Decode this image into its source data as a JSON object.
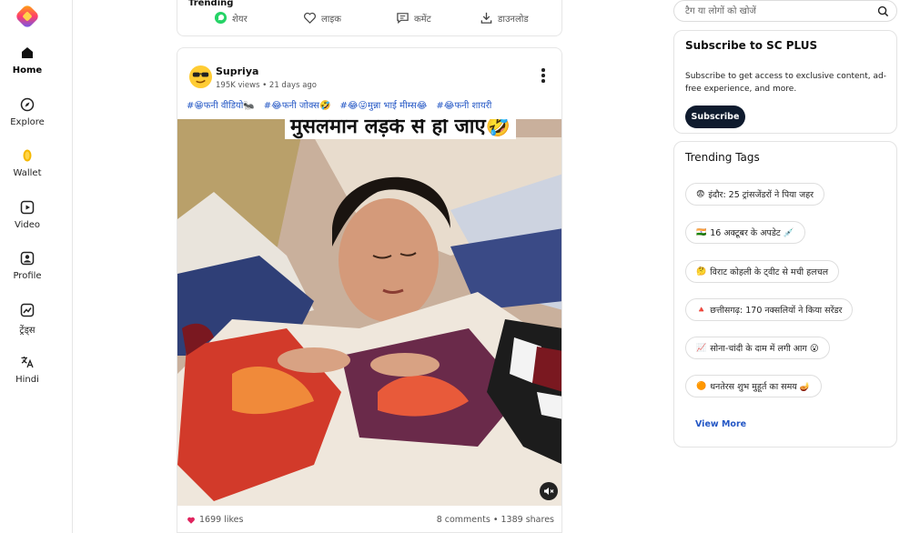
{
  "sidebar": {
    "items": [
      {
        "label": "Home",
        "icon": "home-icon"
      },
      {
        "label": "Explore",
        "icon": "compass-icon"
      },
      {
        "label": "Wallet",
        "icon": "coin-icon"
      },
      {
        "label": "Video",
        "icon": "video-icon"
      },
      {
        "label": "Profile",
        "icon": "profile-icon"
      },
      {
        "label": "ट्रेंड्स",
        "icon": "trends-icon"
      },
      {
        "label": "Hindi",
        "icon": "translate-icon"
      }
    ]
  },
  "feed": {
    "trending_label": "Trending",
    "share_actions": [
      {
        "label": "शेयर",
        "icon": "whatsapp-icon"
      },
      {
        "label": "लाइक",
        "icon": "heart-icon"
      },
      {
        "label": "कमेंट",
        "icon": "comment-icon"
      },
      {
        "label": "डाउनलोड",
        "icon": "download-icon"
      }
    ],
    "post": {
      "author": "Supriya",
      "meta": "195K views • 21 days ago",
      "tags": [
        "#😁फनी वीडियो🐜",
        "#😂फनी जोक्स🤣",
        "#😂😜मुन्ना भाई मीम्स😂",
        "#😂फनी शायरी"
      ],
      "caption": "मुसलमान लड़के से हो जाए🤣",
      "likes": "1699 likes",
      "comments": "8 comments",
      "shares": "1389 shares"
    }
  },
  "search": {
    "placeholder": "टैग या लोगों को खोजें"
  },
  "plus": {
    "title": "Subscribe to SC PLUS",
    "description": "Subscribe to get access to exclusive content, ad-free experience, and more.",
    "button": "Subscribe"
  },
  "trending": {
    "title": "Trending Tags",
    "tags": [
      {
        "emoji": "😨",
        "text": "इंदौर: 25 ट्रांसजेंडरों ने पिया जहर"
      },
      {
        "emoji": "🇮🇳",
        "text": "16 अक्टूबर के अपडेट 💉"
      },
      {
        "emoji": "🤔",
        "text": "विराट कोहली के ट्वीट से मची हलचल"
      },
      {
        "emoji": "🔺",
        "text": "छत्तीसगढ़: 170 नक्सलियों ने किया सरेंडर"
      },
      {
        "emoji": "📈",
        "text": "सोना-चांदी के दाम में लगी आग 😮"
      },
      {
        "emoji": "🟠",
        "text": "धनतेरस शुभ मुहूर्त का समय 🪔"
      }
    ],
    "view_more": "View More"
  },
  "colors": {
    "accent": "#2457c5",
    "subscribe_button": "#0f1b2e",
    "like_heart": "#e0245e"
  }
}
